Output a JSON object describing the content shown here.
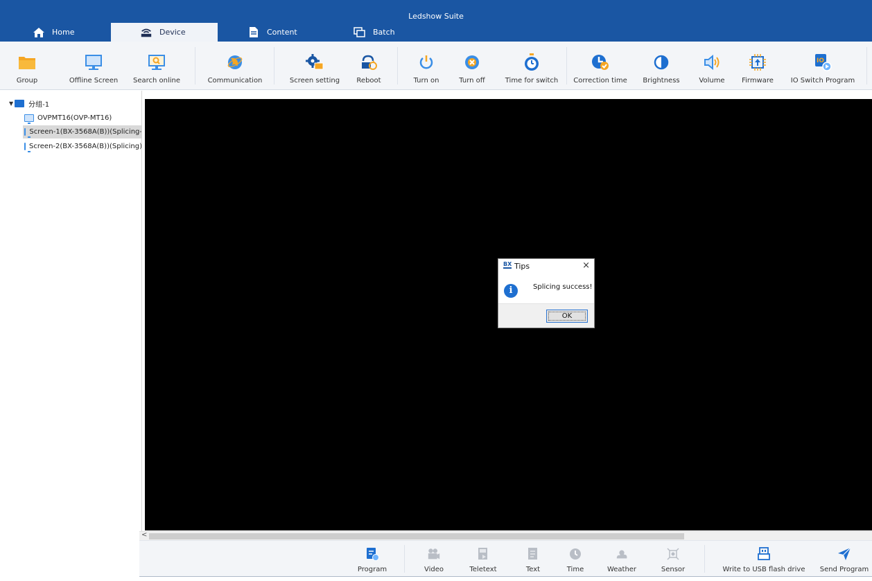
{
  "app": {
    "title": "Ledshow Suite",
    "accent": "#1a56a3"
  },
  "tabs": [
    {
      "label": "Home",
      "icon": "home-icon",
      "active": false
    },
    {
      "label": "Device",
      "icon": "device-router-icon",
      "active": true
    },
    {
      "label": "Content",
      "icon": "document-icon",
      "active": false
    },
    {
      "label": "Batch",
      "icon": "batch-copy-icon",
      "active": false
    }
  ],
  "ribbon": [
    {
      "label": "Group",
      "icon": "folder-icon"
    },
    {
      "label": "Offline Screen",
      "icon": "monitor-icon"
    },
    {
      "label": "Search online",
      "icon": "search-monitor-icon"
    },
    {
      "label": "Communication",
      "icon": "globe-icon"
    },
    {
      "label": "Screen setting",
      "icon": "gear-screen-icon"
    },
    {
      "label": "Reboot",
      "icon": "reboot-icon"
    },
    {
      "label": "Turn on",
      "icon": "power-on-icon"
    },
    {
      "label": "Turn off",
      "icon": "power-off-icon"
    },
    {
      "label": "Time for switch",
      "icon": "stopwatch-icon"
    },
    {
      "label": "Correction time",
      "icon": "clock-check-icon"
    },
    {
      "label": "Brightness",
      "icon": "brightness-icon"
    },
    {
      "label": "Volume",
      "icon": "volume-icon"
    },
    {
      "label": "Firmware",
      "icon": "chip-icon"
    },
    {
      "label": "IO Switch Program",
      "icon": "io-switch-icon"
    }
  ],
  "tree": {
    "group_label": "分组-1",
    "items": [
      {
        "label": "OVPMT16(OVP-MT16)",
        "selected": false
      },
      {
        "label": "Screen-1(BX-3568A(B))(Splicing-",
        "selected": true
      },
      {
        "label": "Screen-2(BX-3568A(B))(Splicing)",
        "selected": false
      }
    ]
  },
  "scrollbar": {
    "left_arrow": "<"
  },
  "bottom_tools": [
    {
      "label": "Program",
      "icon": "program-icon",
      "enabled": true
    },
    {
      "label": "Video",
      "icon": "video-icon",
      "enabled": false
    },
    {
      "label": "Teletext",
      "icon": "teletext-icon",
      "enabled": false
    },
    {
      "label": "Text",
      "icon": "text-icon",
      "enabled": false
    },
    {
      "label": "Time",
      "icon": "time-icon",
      "enabled": false
    },
    {
      "label": "Weather",
      "icon": "weather-icon",
      "enabled": false
    },
    {
      "label": "Sensor",
      "icon": "sensor-icon",
      "enabled": false
    },
    {
      "label": "Write to USB flash drive",
      "icon": "usb-drive-icon",
      "enabled": true
    },
    {
      "label": "Send Program",
      "icon": "send-icon",
      "enabled": true
    }
  ],
  "dialog": {
    "logo": "BX",
    "title": "Tips",
    "close": "×",
    "info_glyph": "i",
    "message": "Splicing success!",
    "ok_label": "OK"
  }
}
